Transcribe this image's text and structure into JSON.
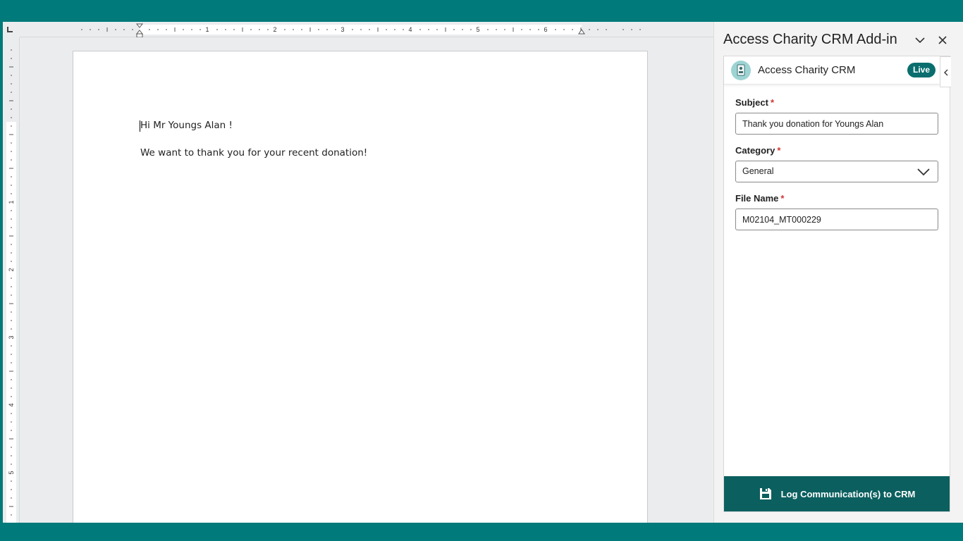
{
  "document": {
    "lines": [
      "Hi Mr Youngs Alan !",
      "We want to thank you for your recent donation!"
    ],
    "ruler_numbers": [
      "1",
      "2",
      "3",
      "4",
      "5",
      "6"
    ],
    "vruler_numbers": [
      "1",
      "2",
      "3",
      "4",
      "5"
    ]
  },
  "panel": {
    "title": "Access Charity CRM Add-in",
    "addin_name": "Access Charity CRM",
    "badge": "Live",
    "fields": {
      "subject_label": "Subject",
      "subject_value": "Thank you donation for Youngs Alan",
      "category_label": "Category",
      "category_value": "General",
      "filename_label": "File Name",
      "filename_value": "M02104_MT000229",
      "required_mark": "*"
    },
    "submit_label": "Log Communication(s) to CRM"
  },
  "colors": {
    "accent": "#0a6e6e",
    "button": "#0c5f5f",
    "background": "#007a7a",
    "required": "#d13438"
  }
}
